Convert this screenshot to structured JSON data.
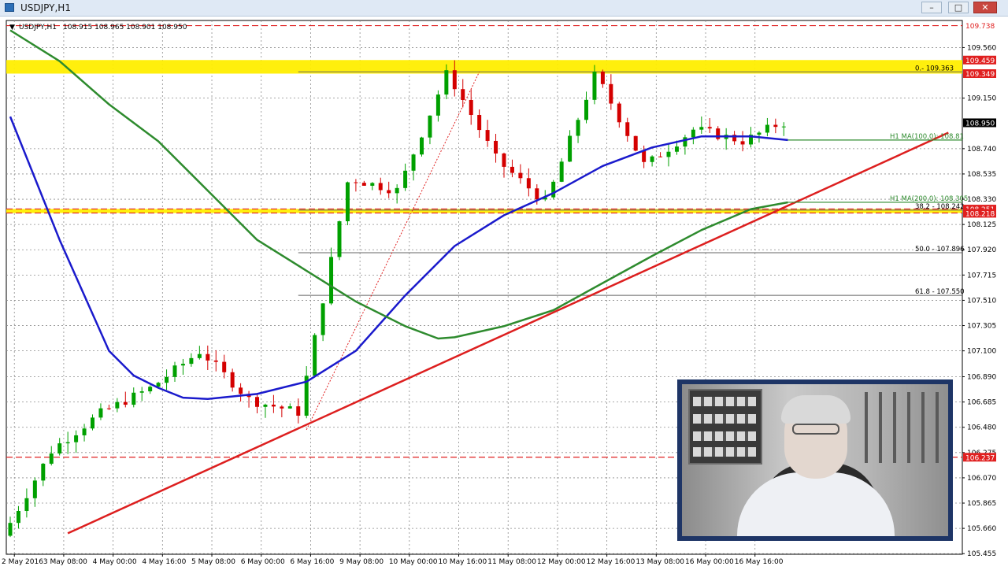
{
  "window": {
    "title": "USDJPY,H1",
    "minimize_glyph": "–",
    "maximize_glyph": "□",
    "close_glyph": "✕"
  },
  "chart_info": {
    "arrow": "▼",
    "symbol": "USDJPY,H1",
    "ohlc": "108.915 108.965 108.901 108.950"
  },
  "colors": {
    "candle_up": "#00a000",
    "candle_down": "#d40000",
    "ma100": "#1a1acc",
    "ma200": "#2e8b2e",
    "trendline": "#dd1f1f",
    "yellow_zone": "#ffee00"
  },
  "chart_data": {
    "type": "line",
    "price_axis": {
      "ylim": [
        105.45,
        109.78
      ],
      "ticks": [
        109.56,
        109.15,
        108.74,
        108.535,
        108.33,
        108.125,
        107.92,
        107.715,
        107.51,
        107.305,
        107.1,
        106.89,
        106.685,
        106.48,
        106.275,
        106.07,
        105.865,
        105.66,
        105.455
      ],
      "tick_labels": [
        "109.560",
        "109.150",
        "108.740",
        "108.535",
        "108.330",
        "108.125",
        "107.920",
        "107.715",
        "107.510",
        "107.305",
        "107.100",
        "106.890",
        "106.685",
        "106.480",
        "106.275",
        "106.070",
        "105.865",
        "105.660",
        "105.455"
      ]
    },
    "time_axis": {
      "labels": [
        "2 May 2016",
        "3 May 08:00",
        "4 May 00:00",
        "4 May 16:00",
        "5 May 08:00",
        "6 May 00:00",
        "6 May 16:00",
        "9 May 08:00",
        "10 May 00:00",
        "10 May 16:00",
        "11 May 08:00",
        "12 May 00:00",
        "12 May 16:00",
        "13 May 08:00",
        "16 May 00:00",
        "16 May 16:00"
      ],
      "positions": [
        0.5,
        6.5,
        12.5,
        18.5,
        24.5,
        30.5,
        36.5,
        42.5,
        48.5,
        54.5,
        60.5,
        66.5,
        72.5,
        78.5,
        84.5,
        90.5
      ]
    },
    "price_boxes": [
      {
        "value": 109.738,
        "label": "109.738",
        "type": "line"
      },
      {
        "value": 109.459,
        "label": "109.459",
        "type": "red"
      },
      {
        "value": 109.349,
        "label": "109.349",
        "type": "red"
      },
      {
        "value": 108.95,
        "label": "108.950",
        "type": "black"
      },
      {
        "value": 108.25,
        "label": "108.251",
        "type": "red"
      },
      {
        "value": 108.216,
        "label": "108.218",
        "type": "red"
      },
      {
        "value": 106.237,
        "label": "106.237",
        "type": "red"
      }
    ],
    "zones": [
      {
        "from": 109.349,
        "to": 109.459
      },
      {
        "from": 108.218,
        "to": 108.251
      }
    ],
    "dashed_levels": [
      109.738,
      108.251,
      108.218,
      106.237
    ],
    "fibonacci": {
      "anchor_low": {
        "x": 36,
        "y": 106.46
      },
      "anchor_high": {
        "x": 57,
        "y": 109.363
      },
      "levels": [
        {
          "value": 109.363,
          "label": "0.- 109.363"
        },
        {
          "value": 108.242,
          "label": "38.2 - 108.242"
        },
        {
          "value": 107.896,
          "label": "50.0 - 107.896"
        },
        {
          "value": 107.55,
          "label": "61.8 - 107.550"
        }
      ]
    },
    "indicators": [
      {
        "label": "H1 MA(100,0): 108.81",
        "value": 108.81
      },
      {
        "label": "H1 MA(200,0): 108.305",
        "value": 108.305
      }
    ],
    "series": [
      {
        "x": [
          0,
          6,
          12,
          18,
          24,
          30,
          36,
          42,
          48,
          54,
          60,
          66,
          72,
          78,
          84,
          90,
          94.5
        ],
        "y": [
          105.6,
          106.3,
          106.6,
          106.8,
          107.1,
          106.7,
          106.6,
          108.5,
          108.4,
          109.36,
          108.65,
          108.3,
          109.35,
          108.6,
          108.9,
          108.8,
          108.95
        ]
      },
      {
        "x": [
          0,
          6,
          12,
          15,
          18,
          21,
          24,
          30,
          36,
          42,
          48,
          54,
          60,
          66,
          72,
          78,
          84,
          90,
          94.5
        ],
        "y": [
          109.0,
          108.0,
          107.1,
          106.9,
          106.8,
          106.72,
          106.71,
          106.75,
          106.85,
          107.1,
          107.55,
          107.95,
          108.2,
          108.38,
          108.6,
          108.75,
          108.84,
          108.84,
          108.81
        ]
      },
      {
        "x": [
          0,
          6,
          12,
          18,
          24,
          30,
          36,
          42,
          48,
          52,
          54,
          60,
          66,
          72,
          78,
          84,
          90,
          94.5
        ],
        "y": [
          109.7,
          109.45,
          109.1,
          108.8,
          108.4,
          108.0,
          107.75,
          107.5,
          107.3,
          107.2,
          107.21,
          107.3,
          107.43,
          107.65,
          107.87,
          108.08,
          108.25,
          108.305
        ]
      },
      {
        "x": [
          7,
          114
        ],
        "y": [
          105.62,
          108.87
        ]
      }
    ]
  }
}
